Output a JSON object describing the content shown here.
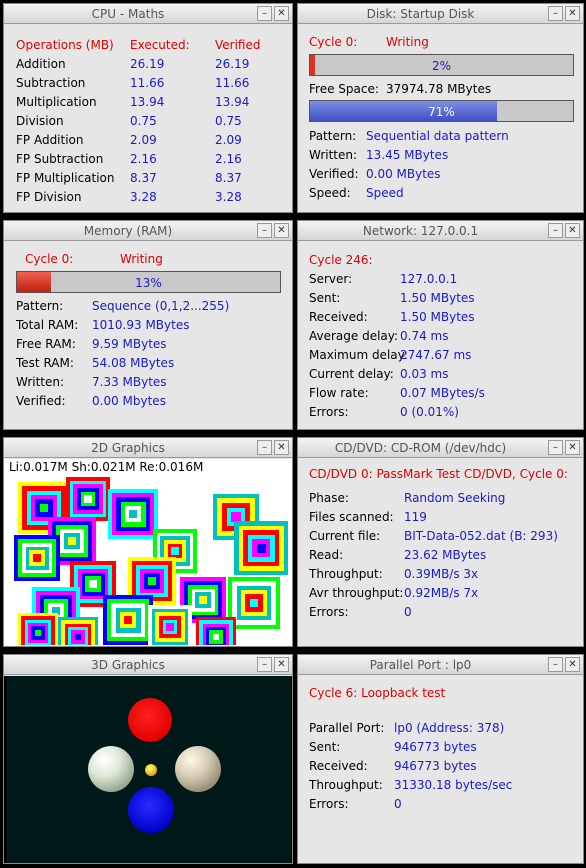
{
  "cpu": {
    "title": "CPU - Maths",
    "headers": [
      "Operations (MB)",
      "Executed:",
      "Verified"
    ],
    "rows": [
      {
        "op": "Addition",
        "exec": "26.19",
        "ver": "26.19"
      },
      {
        "op": "Subtraction",
        "exec": "11.66",
        "ver": "11.66"
      },
      {
        "op": "Multiplication",
        "exec": "13.94",
        "ver": "13.94"
      },
      {
        "op": "Division",
        "exec": "0.75",
        "ver": "0.75"
      },
      {
        "op": "FP Addition",
        "exec": "2.09",
        "ver": "2.09"
      },
      {
        "op": "FP Subtraction",
        "exec": "2.16",
        "ver": "2.16"
      },
      {
        "op": "FP Multiplication",
        "exec": "8.37",
        "ver": "8.37"
      },
      {
        "op": "FP Division",
        "exec": "3.28",
        "ver": "3.28"
      }
    ]
  },
  "disk": {
    "title": "Disk: Startup Disk",
    "cycle": "Cycle 0:",
    "status": "Writing",
    "progress_text": "2%",
    "progress": 0.02,
    "free_space_label": "Free Space:",
    "free_space": "37974.78 MBytes",
    "space_text": "71%",
    "space": 0.71,
    "fields": [
      {
        "label": "Pattern:",
        "value": "Sequential data pattern"
      },
      {
        "label": "Written:",
        "value": "13.45 MBytes"
      },
      {
        "label": "Verified:",
        "value": "0.00 MBytes"
      },
      {
        "label": "Speed:",
        "value": "Speed"
      }
    ]
  },
  "memory": {
    "title": "Memory (RAM)",
    "cycle": "Cycle 0:",
    "status": "Writing",
    "progress_text": "13%",
    "progress": 0.13,
    "fields": [
      {
        "label": "Pattern:",
        "value": "Sequence (0,1,2...255)"
      },
      {
        "label": "Total RAM:",
        "value": "1010.93 MBytes"
      },
      {
        "label": "Free RAM:",
        "value": "9.59 MBytes"
      },
      {
        "label": "Test RAM:",
        "value": "54.08 MBytes"
      },
      {
        "label": "Written:",
        "value": "7.33 MBytes"
      },
      {
        "label": "Verified:",
        "value": "0.00 Mbytes"
      }
    ]
  },
  "network": {
    "title": "Network: 127.0.0.1",
    "cycle": "Cycle 246:",
    "fields": [
      {
        "label": "Server:",
        "value": "127.0.0.1"
      },
      {
        "label": "Sent:",
        "value": "1.50 MBytes"
      },
      {
        "label": "Received:",
        "value": "1.50 MBytes"
      },
      {
        "label": "Average delay:",
        "value": "0.74 ms"
      },
      {
        "label": "Maximum delay:",
        "value": "2747.67 ms"
      },
      {
        "label": "Current delay:",
        "value": "0.03 ms"
      },
      {
        "label": "Flow rate:",
        "value": "0.07 MBytes/s"
      },
      {
        "label": "Errors:",
        "value": "0 (0.01%)"
      }
    ]
  },
  "graphics2d": {
    "title": "2D Graphics",
    "stats": "Li:0.017M  Sh:0.021M  Re:0.016M"
  },
  "cdrom": {
    "title": "CD/DVD: CD-ROM (/dev/hdc)",
    "header": "CD/DVD 0: PassMark Test CD/DVD, Cycle 0:",
    "fields": [
      {
        "label": "Phase:",
        "value": "Random Seeking"
      },
      {
        "label": "Files scanned:",
        "value": "119"
      },
      {
        "label": "Current file:",
        "value": "BIT-Data-052.dat (B: 293)"
      },
      {
        "label": "Read:",
        "value": "23.62 MBytes"
      },
      {
        "label": "Throughput:",
        "value": "0.39MB/s 3x"
      },
      {
        "label": "Avr throughput:",
        "value": "0.92MB/s 7x"
      },
      {
        "label": "Errors:",
        "value": "0"
      }
    ]
  },
  "graphics3d": {
    "title": "3D Graphics"
  },
  "parallel": {
    "title": "Parallel Port : lp0",
    "header": "Cycle 6: Loopback test",
    "fields": [
      {
        "label": "Parallel Port:",
        "value": "lp0 (Address: 378)"
      },
      {
        "label": "Sent:",
        "value": "946773 bytes"
      },
      {
        "label": "Received:",
        "value": "946773 bytes"
      },
      {
        "label": "Throughput:",
        "value": "31330.18 bytes/sec"
      },
      {
        "label": "Errors:",
        "value": "0"
      }
    ]
  },
  "window_buttons": {
    "minimize": "–",
    "close": "✕"
  },
  "colors": {
    "label_red": "#e00000",
    "value_blue": "#1a1acc",
    "bar_red": "#e03020",
    "bar_blue": "#4b5fd0"
  }
}
